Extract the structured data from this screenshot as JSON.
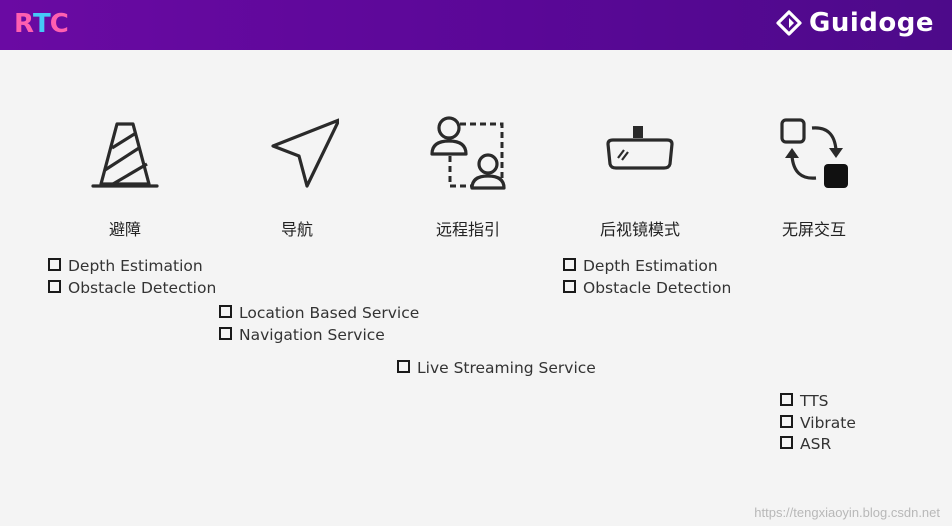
{
  "header": {
    "logo_left_letters": [
      "R",
      "T",
      "C"
    ],
    "logo_left_colors": [
      "#ff5fb0",
      "#45c9f7",
      "#ff5fb0"
    ],
    "brand_name": "Guidoge",
    "bar_color": "#5a0797"
  },
  "features": [
    {
      "label": "避障",
      "icon": "traffic-cone-icon"
    },
    {
      "label": "导航",
      "icon": "navigation-arrow-icon"
    },
    {
      "label": "远程指引",
      "icon": "remote-users-icon"
    },
    {
      "label": "后视镜模式",
      "icon": "rearview-mirror-icon"
    },
    {
      "label": "无屏交互",
      "icon": "interaction-cycle-icon"
    }
  ],
  "lists": {
    "obstacle": [
      "Depth Estimation",
      "Obstacle Detection"
    ],
    "navigation": [
      "Location Based Service",
      "Navigation Service"
    ],
    "remote": [
      "Live Streaming Service"
    ],
    "mirror": [
      "Depth Estimation",
      "Obstacle Detection"
    ],
    "screenless": [
      "TTS",
      "Vibrate",
      "ASR"
    ]
  },
  "watermark": "https://tengxiaoyin.blog.csdn.net"
}
